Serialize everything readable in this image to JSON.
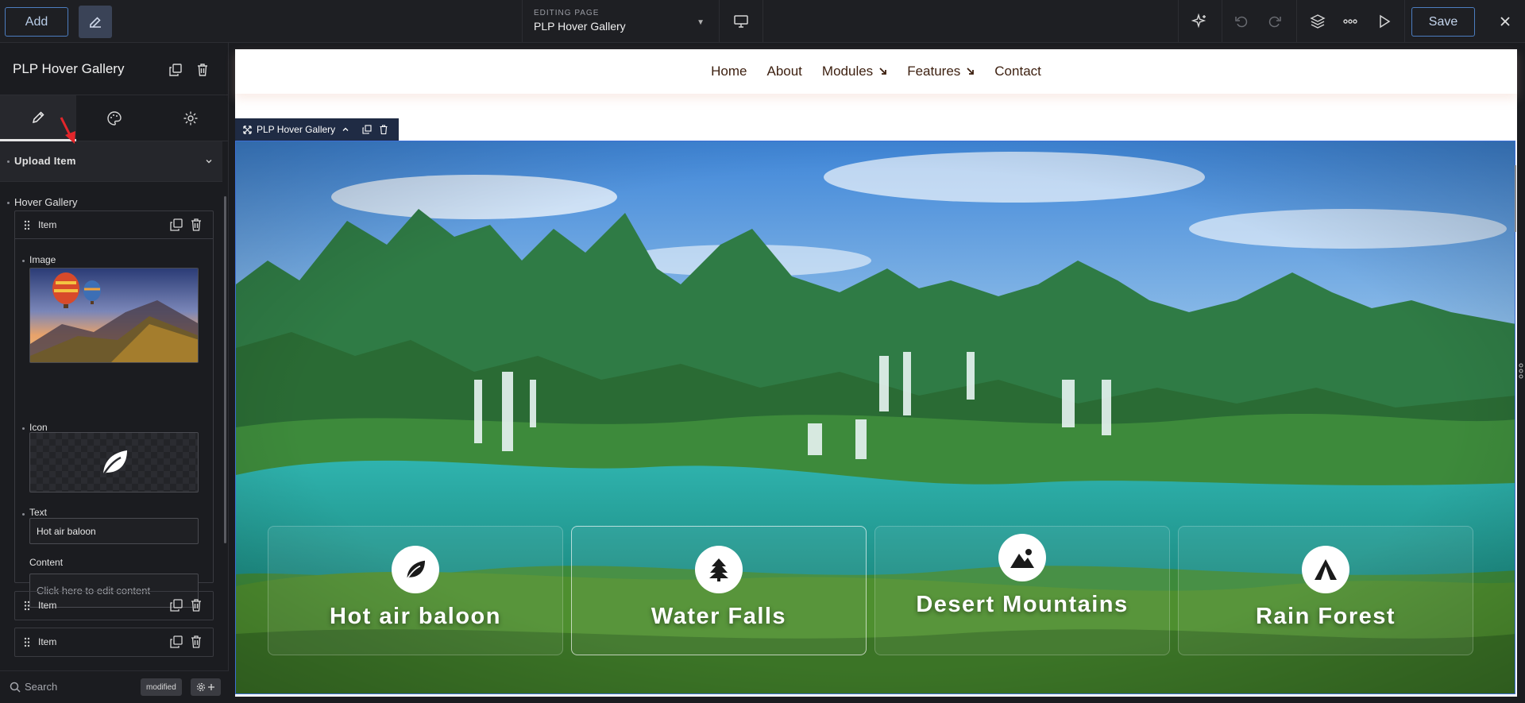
{
  "topbar": {
    "add_label": "Add",
    "editing_caption": "EDITING PAGE",
    "page_name": "PLP Hover Gallery",
    "save_label": "Save"
  },
  "sidebar": {
    "title": "PLP Hover Gallery",
    "upload_section": "Upload Item",
    "gallery_label": "Hover Gallery",
    "items": [
      {
        "label": "Item",
        "image_label": "Image",
        "icon_label": "Icon",
        "icon": "leaf-icon",
        "text_label": "Text",
        "text_value": "Hot air baloon",
        "content_label": "Content",
        "content_placeholder": "Click here to edit content"
      },
      {
        "label": "Item"
      },
      {
        "label": "Item"
      }
    ],
    "search_label": "Search",
    "modified_badge": "modified"
  },
  "canvas": {
    "nav": [
      "Home",
      "About",
      "Modules",
      "Features",
      "Contact"
    ],
    "module_tab_label": "PLP Hover Gallery",
    "cards": [
      {
        "title": "Hot air baloon",
        "icon": "leaf-icon"
      },
      {
        "title": "Water Falls",
        "icon": "tree-icon"
      },
      {
        "title": "Desert Mountains",
        "icon": "mountain-image-icon"
      },
      {
        "title": "Rain Forest",
        "icon": "tent-icon"
      }
    ]
  },
  "colors": {
    "accent": "#4c7dc0",
    "selection_border": "#3d6fd6",
    "module_tab": "#1f2b44",
    "nav_text": "#3c1f0f"
  }
}
